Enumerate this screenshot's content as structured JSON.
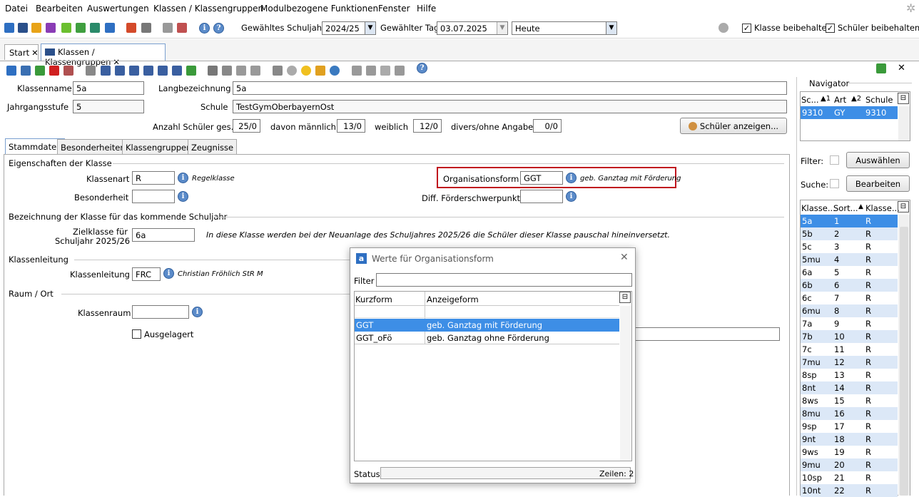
{
  "menu": [
    "Datei",
    "Bearbeiten",
    "Auswertungen",
    "Klassen / Klassengruppen",
    "Modulbezogene Funktionen",
    "Fenster",
    "Hilfe"
  ],
  "toolbar": {
    "schuljahr_label": "Gewähltes Schuljahr",
    "schuljahr_value": "2024/25",
    "tag_label": "Gewählter Tag",
    "tag_value": "03.07.2025",
    "heute_value": "Heute",
    "klasse_beibehalten": "Klasse beibehalten",
    "schueler_beibehalten": "Schüler beibehalten"
  },
  "doc_tabs": [
    "Start",
    "Klassen / Klassengruppen"
  ],
  "header": {
    "klassenname_label": "Klassenname",
    "klassenname": "5a",
    "langbezeichnung_label": "Langbezeichnung",
    "langbezeichnung": "5a",
    "jahrgang_label": "Jahrgangsstufe",
    "jahrgang": "5",
    "schule_label": "Schule",
    "schule": "TestGymOberbayernOst",
    "anzahl_label": "Anzahl Schüler ges.",
    "anzahl": "25/0",
    "maennlich_label": "davon männlich",
    "maennlich": "13/0",
    "weiblich_label": "weiblich",
    "weiblich": "12/0",
    "divers_label": "divers/ohne Angabe",
    "divers": "0/0",
    "schueler_btn": "Schüler anzeigen..."
  },
  "form_tabs": [
    "Stammdaten",
    "Besonderheiten",
    "Klassengruppen",
    "Zeugnisse"
  ],
  "stammdaten": {
    "sec1": "Eigenschaften der Klasse",
    "klassenart_label": "Klassenart",
    "klassenart": "R",
    "klassenart_hint": "Regelklasse",
    "besonderheit_label": "Besonderheit",
    "besonderheit": "",
    "orgform_label": "Organisationsform",
    "orgform": "GGT",
    "orgform_hint": "geb. Ganztag mit Förderung",
    "foerder_label": "Diff. Förderschwerpunkt",
    "foerder": "",
    "sec2": "Bezeichnung der Klasse für das kommende Schuljahr",
    "ziel_label1": "Zielklasse für",
    "ziel_label2": "Schuljahr 2025/26",
    "ziel": "6a",
    "ziel_hint": "In diese Klasse werden bei der Neuanlage des Schuljahres 2025/26 die Schüler dieser Klasse pauschal hineinversetzt.",
    "sec3": "Klassenleitung",
    "leitung_label": "Klassenleitung",
    "leitung": "FRC",
    "leitung_hint": "Christian Fröhlich StR M",
    "sec4": "Raum / Ort",
    "raum_label": "Klassenraum",
    "raum": "",
    "ausgelagert_label": "Ausgelagert"
  },
  "navigator": {
    "title": "Navigator",
    "cols": [
      "Sc...",
      "▲1",
      "Art",
      "▲2",
      "Schule"
    ],
    "row": [
      "9310",
      "GY",
      "9310"
    ],
    "filter_label": "Filter:",
    "auswaehlen": "Auswählen",
    "suche_label": "Suche:",
    "bearbeiten": "Bearbeiten",
    "list_cols": [
      "Klasse...",
      "Sort...",
      "Klasse..."
    ],
    "rows": [
      [
        "5a",
        "1",
        "R"
      ],
      [
        "5b",
        "2",
        "R"
      ],
      [
        "5c",
        "3",
        "R"
      ],
      [
        "5mu",
        "4",
        "R"
      ],
      [
        "6a",
        "5",
        "R"
      ],
      [
        "6b",
        "6",
        "R"
      ],
      [
        "6c",
        "7",
        "R"
      ],
      [
        "6mu",
        "8",
        "R"
      ],
      [
        "7a",
        "9",
        "R"
      ],
      [
        "7b",
        "10",
        "R"
      ],
      [
        "7c",
        "11",
        "R"
      ],
      [
        "7mu",
        "12",
        "R"
      ],
      [
        "8sp",
        "13",
        "R"
      ],
      [
        "8nt",
        "14",
        "R"
      ],
      [
        "8ws",
        "15",
        "R"
      ],
      [
        "8mu",
        "16",
        "R"
      ],
      [
        "9sp",
        "17",
        "R"
      ],
      [
        "9nt",
        "18",
        "R"
      ],
      [
        "9ws",
        "19",
        "R"
      ],
      [
        "9mu",
        "20",
        "R"
      ],
      [
        "10sp",
        "21",
        "R"
      ],
      [
        "10nt",
        "22",
        "R"
      ]
    ]
  },
  "dialog": {
    "title": "Werte für Organisationsform",
    "filter_label": "Filter",
    "col1": "Kurzform",
    "col2": "Anzeigeform",
    "rows": [
      [
        "",
        ""
      ],
      [
        "GGT",
        "geb. Ganztag mit Förderung"
      ],
      [
        "GGT_oFö",
        "geb. Ganztag ohne Förderung"
      ]
    ],
    "status_label": "Status",
    "zeilen": "Zeilen: 2"
  },
  "colors": {
    "selection": "#3d8ee6",
    "highlight_border": "#c0141e",
    "row_alt": "#dce8f7"
  }
}
